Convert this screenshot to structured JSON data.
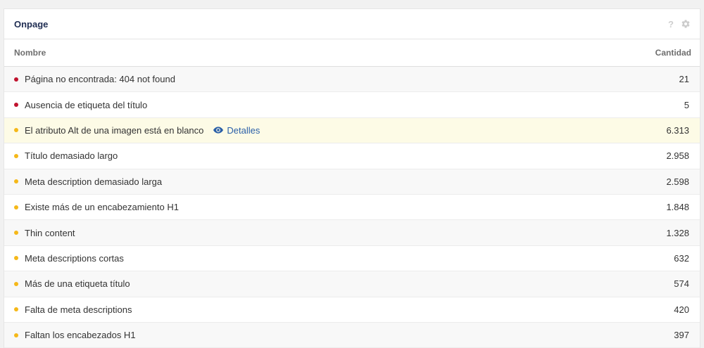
{
  "panel": {
    "title": "Onpage",
    "help_icon": "?",
    "settings_icon": "gear-icon"
  },
  "table": {
    "columns": {
      "name": "Nombre",
      "count": "Cantidad"
    },
    "rows": [
      {
        "label": "Página no encontrada: 404 not found",
        "count": "21",
        "severity": "error",
        "dot_color": "#c0132e"
      },
      {
        "label": "Ausencia de etiqueta del título",
        "count": "5",
        "severity": "error",
        "dot_color": "#c0132e"
      },
      {
        "label": "El atributo Alt de una imagen está en blanco",
        "count": "6.313",
        "severity": "warning",
        "dot_color": "#f5b819",
        "details_label": "Detalles"
      },
      {
        "label": "Título demasiado largo",
        "count": "2.958",
        "severity": "warning",
        "dot_color": "#f5b819"
      },
      {
        "label": "Meta description demasiado larga",
        "count": "2.598",
        "severity": "warning",
        "dot_color": "#f5b819"
      },
      {
        "label": "Existe más de un encabezamiento H1",
        "count": "1.848",
        "severity": "warning",
        "dot_color": "#f5b819"
      },
      {
        "label": "Thin content",
        "count": "1.328",
        "severity": "warning",
        "dot_color": "#f5b819"
      },
      {
        "label": "Meta descriptions cortas",
        "count": "632",
        "severity": "warning",
        "dot_color": "#f5b819"
      },
      {
        "label": "Más de una etiqueta título",
        "count": "574",
        "severity": "warning",
        "dot_color": "#f5b819"
      },
      {
        "label": "Falta de meta descriptions",
        "count": "420",
        "severity": "warning",
        "dot_color": "#f5b819"
      },
      {
        "label": "Faltan los encabezados H1",
        "count": "397",
        "severity": "warning",
        "dot_color": "#f5b819"
      }
    ]
  }
}
